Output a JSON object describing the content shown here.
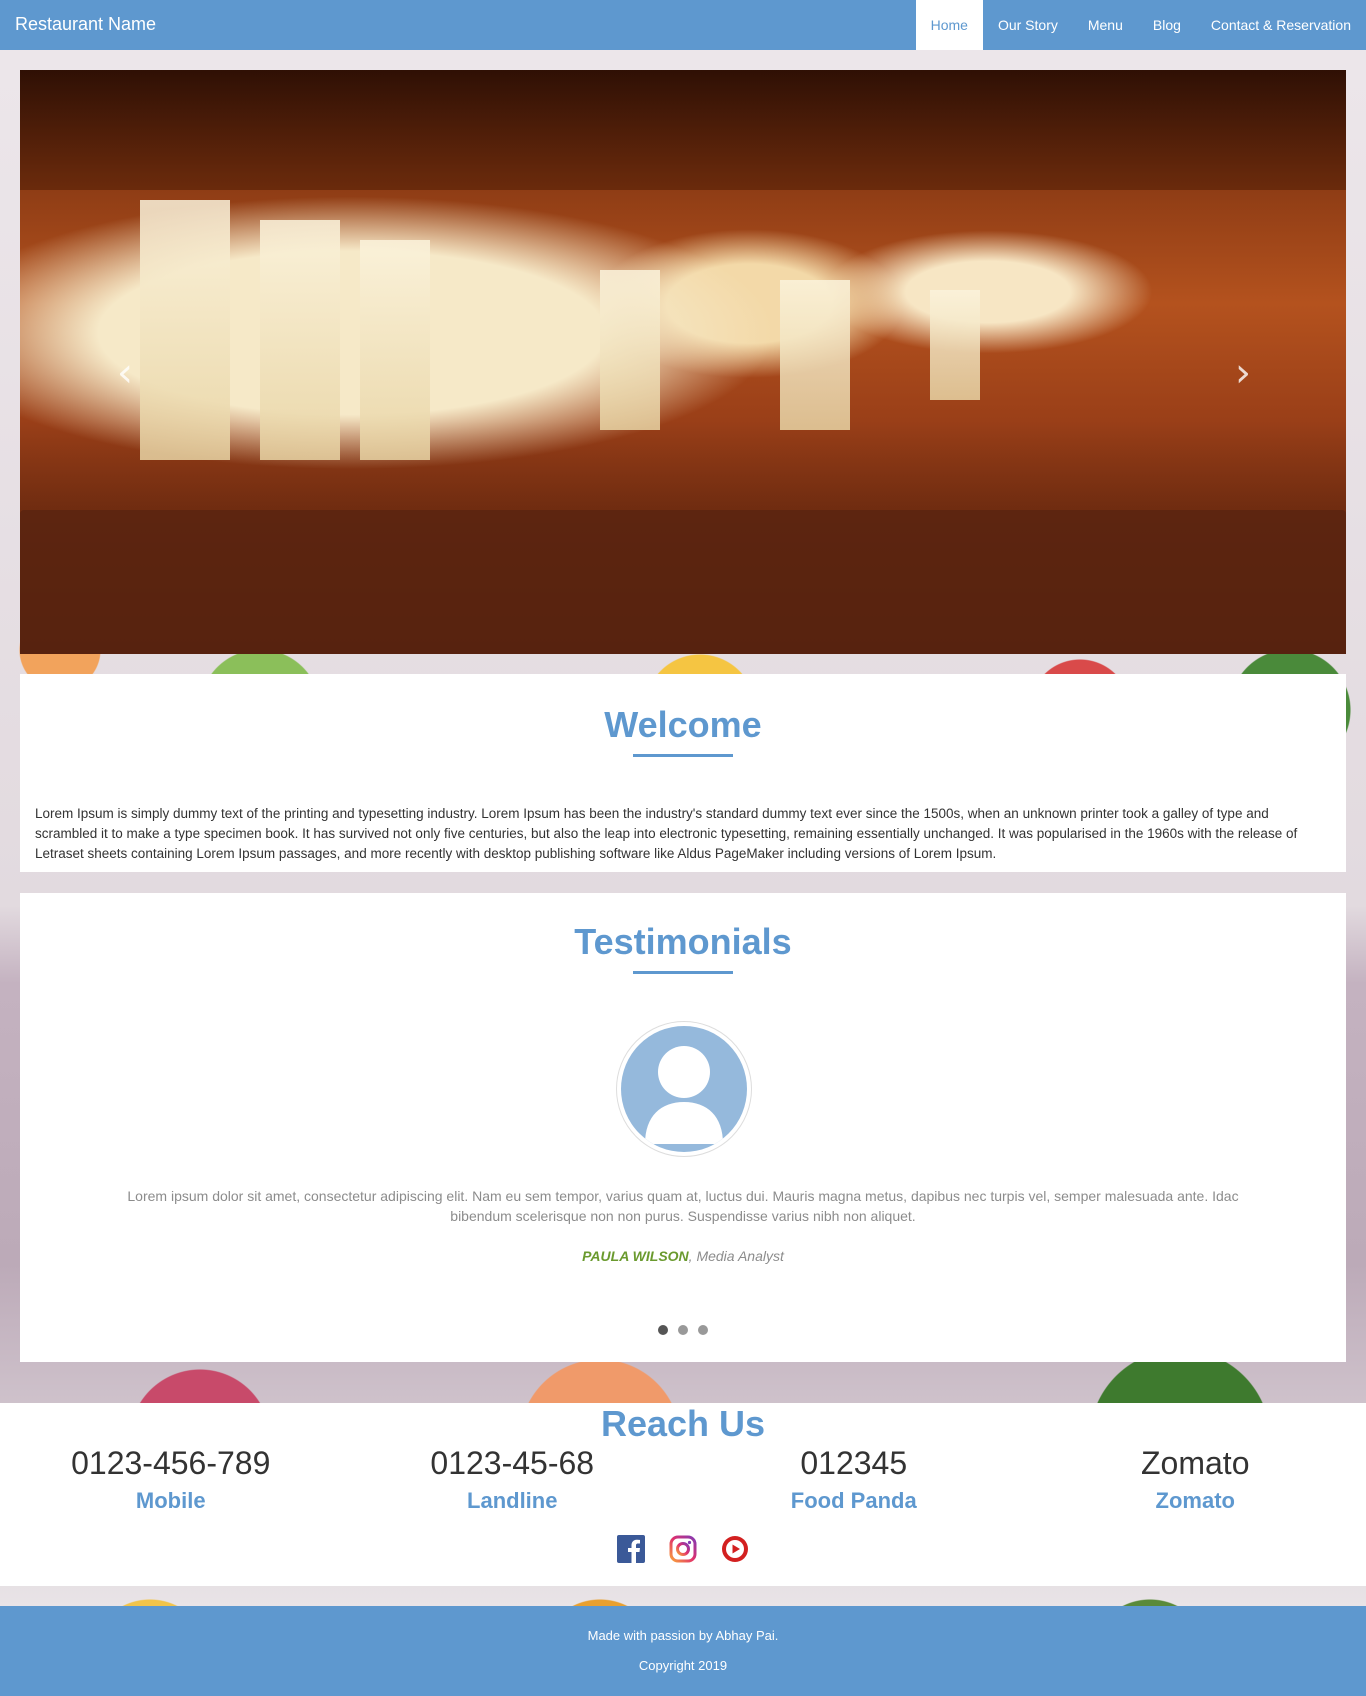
{
  "navbar": {
    "brand": "Restaurant Name",
    "items": [
      {
        "label": "Home",
        "active": true
      },
      {
        "label": "Our Story",
        "active": false
      },
      {
        "label": "Menu",
        "active": false
      },
      {
        "label": "Blog",
        "active": false
      },
      {
        "label": "Contact & Reservation",
        "active": false
      }
    ]
  },
  "carousel": {
    "prev_icon": "chevron-left-icon",
    "next_icon": "chevron-right-icon"
  },
  "welcome": {
    "title": "Welcome",
    "text": "Lorem Ipsum is simply dummy text of the printing and typesetting industry. Lorem Ipsum has been the industry's standard dummy text ever since the 1500s, when an unknown printer took a galley of type and scrambled it to make a type specimen book. It has survived not only five centuries, but also the leap into electronic typesetting, remaining essentially unchanged. It was popularised in the 1960s with the release of Letraset sheets containing Lorem Ipsum passages, and more recently with desktop publishing software like Aldus PageMaker including versions of Lorem Ipsum."
  },
  "testimonials": {
    "title": "Testimonials",
    "quote": "Lorem ipsum dolor sit amet, consectetur adipiscing elit. Nam eu sem tempor, varius quam at, luctus dui. Mauris magna metus, dapibus nec turpis vel, semper malesuada ante. Idac bibendum scelerisque non non purus. Suspendisse varius nibh non aliquet.",
    "author_name": "Paula Wilson",
    "author_role": ", Media Analyst",
    "dots": 3,
    "active_dot": 0
  },
  "reach": {
    "title": "Reach Us",
    "contacts": [
      {
        "value": "0123-456-789",
        "label": "Mobile"
      },
      {
        "value": "0123-45-68",
        "label": "Landline"
      },
      {
        "value": "012345",
        "label": "Food Panda"
      },
      {
        "value": "Zomato",
        "label": "Zomato"
      }
    ],
    "social": [
      "facebook-icon",
      "instagram-icon",
      "youtube-icon"
    ]
  },
  "footer": {
    "line1": "Made with passion by Abhay Pai.",
    "line2": "Copyright 2019"
  },
  "colors": {
    "brand": "#5e98cf",
    "author": "#6a9a2e"
  }
}
